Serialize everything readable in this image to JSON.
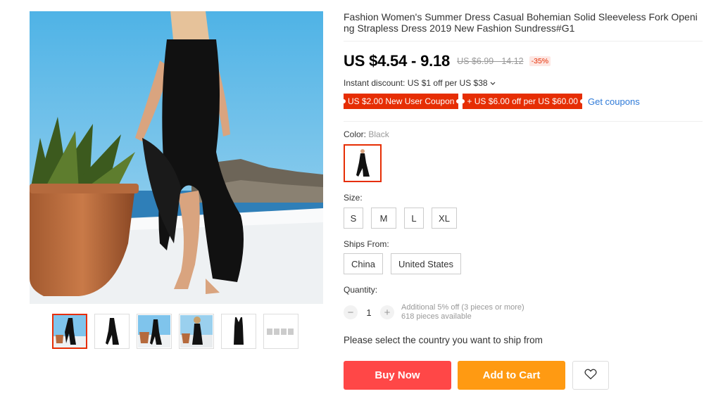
{
  "product": {
    "title": "Fashion Women's Summer Dress Casual Bohemian Solid Sleeveless Fork Opening Strapless Dress 2019 New Fashion Sundress#G1"
  },
  "gallery": {
    "thumb_count": 6,
    "active_index": 0
  },
  "price": {
    "current": "US $4.54 - 9.18",
    "original": "US $6.99 - 14.12",
    "discount": "-35%"
  },
  "promo": {
    "instant_discount": "Instant discount: US $1 off per US $38",
    "coupons": [
      "US $2.00 New User Coupon",
      "+ US $6.00 off per US $60.00"
    ],
    "get_coupons": "Get coupons"
  },
  "color": {
    "label": "Color:",
    "selected": "Black"
  },
  "size": {
    "label": "Size:",
    "options": [
      "S",
      "M",
      "L",
      "XL"
    ]
  },
  "ships_from": {
    "label": "Ships From:",
    "options": [
      "China",
      "United States"
    ]
  },
  "quantity": {
    "label": "Quantity:",
    "minus": "−",
    "value": "1",
    "plus": "+",
    "note_line1": "Additional 5% off (3 pieces or more)",
    "note_line2": "618 pieces available"
  },
  "ship_message": "Please select the country you want to ship from",
  "actions": {
    "buy_now": "Buy Now",
    "add_to_cart": "Add to Cart",
    "wishlist_icon": "heart-icon"
  },
  "colors": {
    "accent": "#e62e04",
    "buy": "#ff4747",
    "cart": "#ff9a12",
    "link": "#2e7ad8"
  }
}
